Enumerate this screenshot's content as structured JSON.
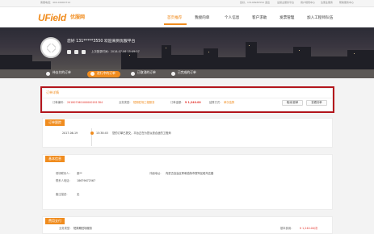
{
  "topbar": {
    "left_text": "客服电话：400-00000714",
    "links": [
      "您好，13148983550 退出",
      "设施业服务平台",
      "用户规则中心",
      "注册业服务",
      "帮助服务中心"
    ]
  },
  "header": {
    "logo": "UField",
    "logo_cn": "优服网",
    "nav": [
      "首页推荐",
      "我接的单",
      "个人信息",
      "客户求助",
      "发票管理",
      "加入工程师队伍"
    ],
    "active_nav": "首页推荐"
  },
  "banner": {
    "user_greeting": "您好 131*****3550  欢迎来到优服平台",
    "login_info": "上次登录时间：2018-07-06 15:49:07"
  },
  "tabs": [
    "待支付的订单",
    "进行中的订单",
    "已取消的订单",
    "已完成的订单"
  ],
  "active_tab": "进行中的订单",
  "order_info": {
    "title": "订单详情",
    "order_no_label": "订单编号：",
    "order_no": "201807061000000181384",
    "service_type_label": "业务类型：",
    "service_type": "短期驻场工程服务",
    "total_label": "订单金额：",
    "total": "¥ 1,240.00",
    "status_label": "结算方式：",
    "status": "单次结算",
    "btn_cancel": "取消/退单",
    "btn_view": "查看清单"
  },
  "order_tracking": {
    "title": "订单跟踪",
    "date": "2017-06-19",
    "time": "15:38:45",
    "message": "您的订单已提交，平台正在为您派遣合适的工程师"
  },
  "basic_info": {
    "title": "基本信息",
    "contact_label": "现场联系人：",
    "contact": "张**",
    "phone_label": "联系人电话：",
    "phone": "18679672567",
    "address_label": "详细地址：",
    "address": "内蒙古自治区呼和浩特市赛罕区昭乌达路",
    "remark_label": "备注描述：",
    "remark": "无"
  },
  "fee_info": {
    "title": "费用支付",
    "service_label": "业务类型：",
    "service": "短周期驻场服务",
    "fee_label": "基本费用：",
    "fee": "¥ 1,240.00/次"
  },
  "icons": {
    "avatar": "user-avatar-icon",
    "badges": [
      "id-card-icon",
      "phone-icon",
      "email-icon"
    ]
  }
}
